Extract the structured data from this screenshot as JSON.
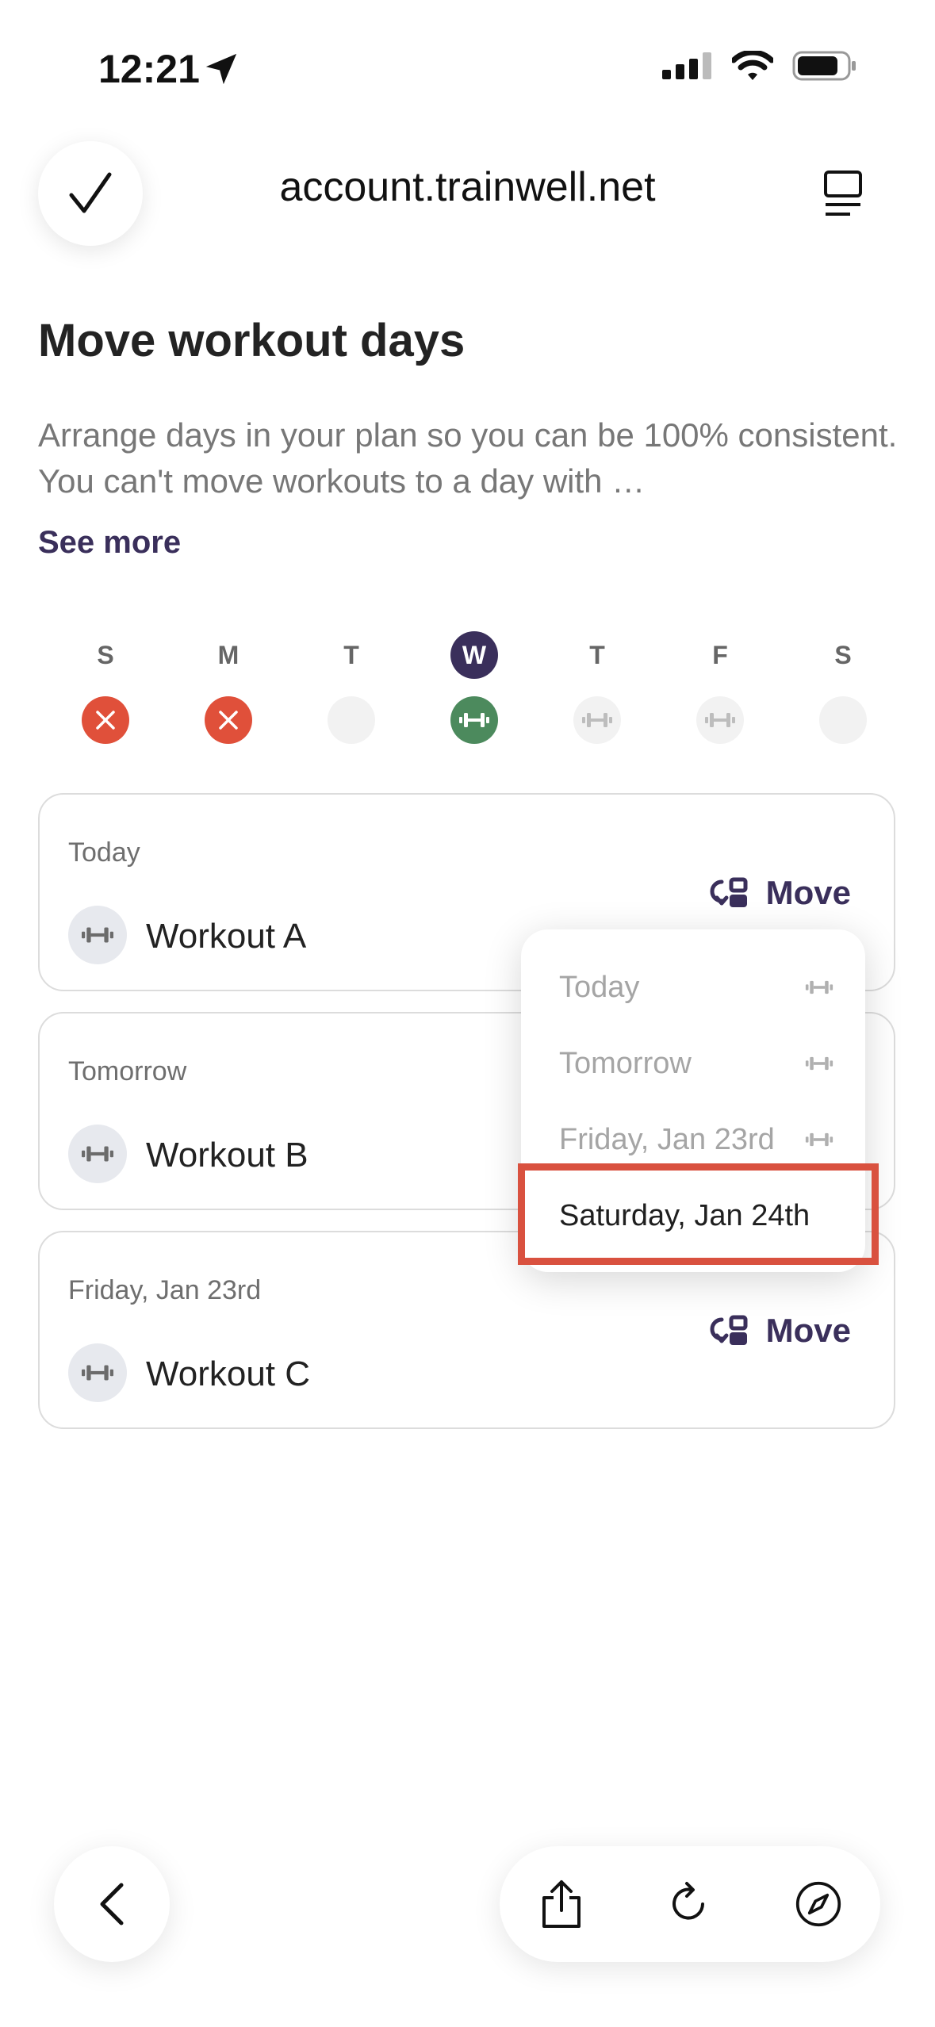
{
  "status_bar": {
    "time": "12:21"
  },
  "browser": {
    "url": "account.trainwell.net"
  },
  "page": {
    "title": "Move workout days",
    "description": "Arrange days in your plan so you can be 100% consistent. You can't move workouts to a day with …",
    "see_more": "See more"
  },
  "week": {
    "days": [
      {
        "letter": "S",
        "state": "missed"
      },
      {
        "letter": "M",
        "state": "missed"
      },
      {
        "letter": "T",
        "state": "empty"
      },
      {
        "letter": "W",
        "state": "done",
        "current": true
      },
      {
        "letter": "T",
        "state": "planned"
      },
      {
        "letter": "F",
        "state": "planned"
      },
      {
        "letter": "S",
        "state": "empty"
      }
    ]
  },
  "cards": [
    {
      "day_label": "Today",
      "workout": "Workout A",
      "move_label": "Move"
    },
    {
      "day_label": "Tomorrow",
      "workout": "Workout B"
    },
    {
      "day_label": "Friday, Jan 23rd",
      "workout": "Workout C",
      "move_label": "Move"
    }
  ],
  "dropdown": {
    "items": [
      {
        "label": "Today",
        "enabled": false,
        "has_workout": true
      },
      {
        "label": "Tomorrow",
        "enabled": false,
        "has_workout": true
      },
      {
        "label": "Friday, Jan 23rd",
        "enabled": false,
        "has_workout": true
      },
      {
        "label": "Saturday, Jan 24th",
        "enabled": true,
        "has_workout": false
      }
    ]
  },
  "icons": {
    "check": "checkmark-icon",
    "reader": "reader-mode-icon",
    "dumbbell": "dumbbell-icon",
    "move": "move-swap-icon",
    "missed": "x-icon",
    "back": "chevron-left-icon",
    "share": "share-icon",
    "reload": "reload-icon",
    "compass": "compass-icon"
  },
  "colors": {
    "brand": "#3a2f5b",
    "missed": "#e0503a",
    "done": "#4c8a5d",
    "highlight": "#d9513f"
  }
}
